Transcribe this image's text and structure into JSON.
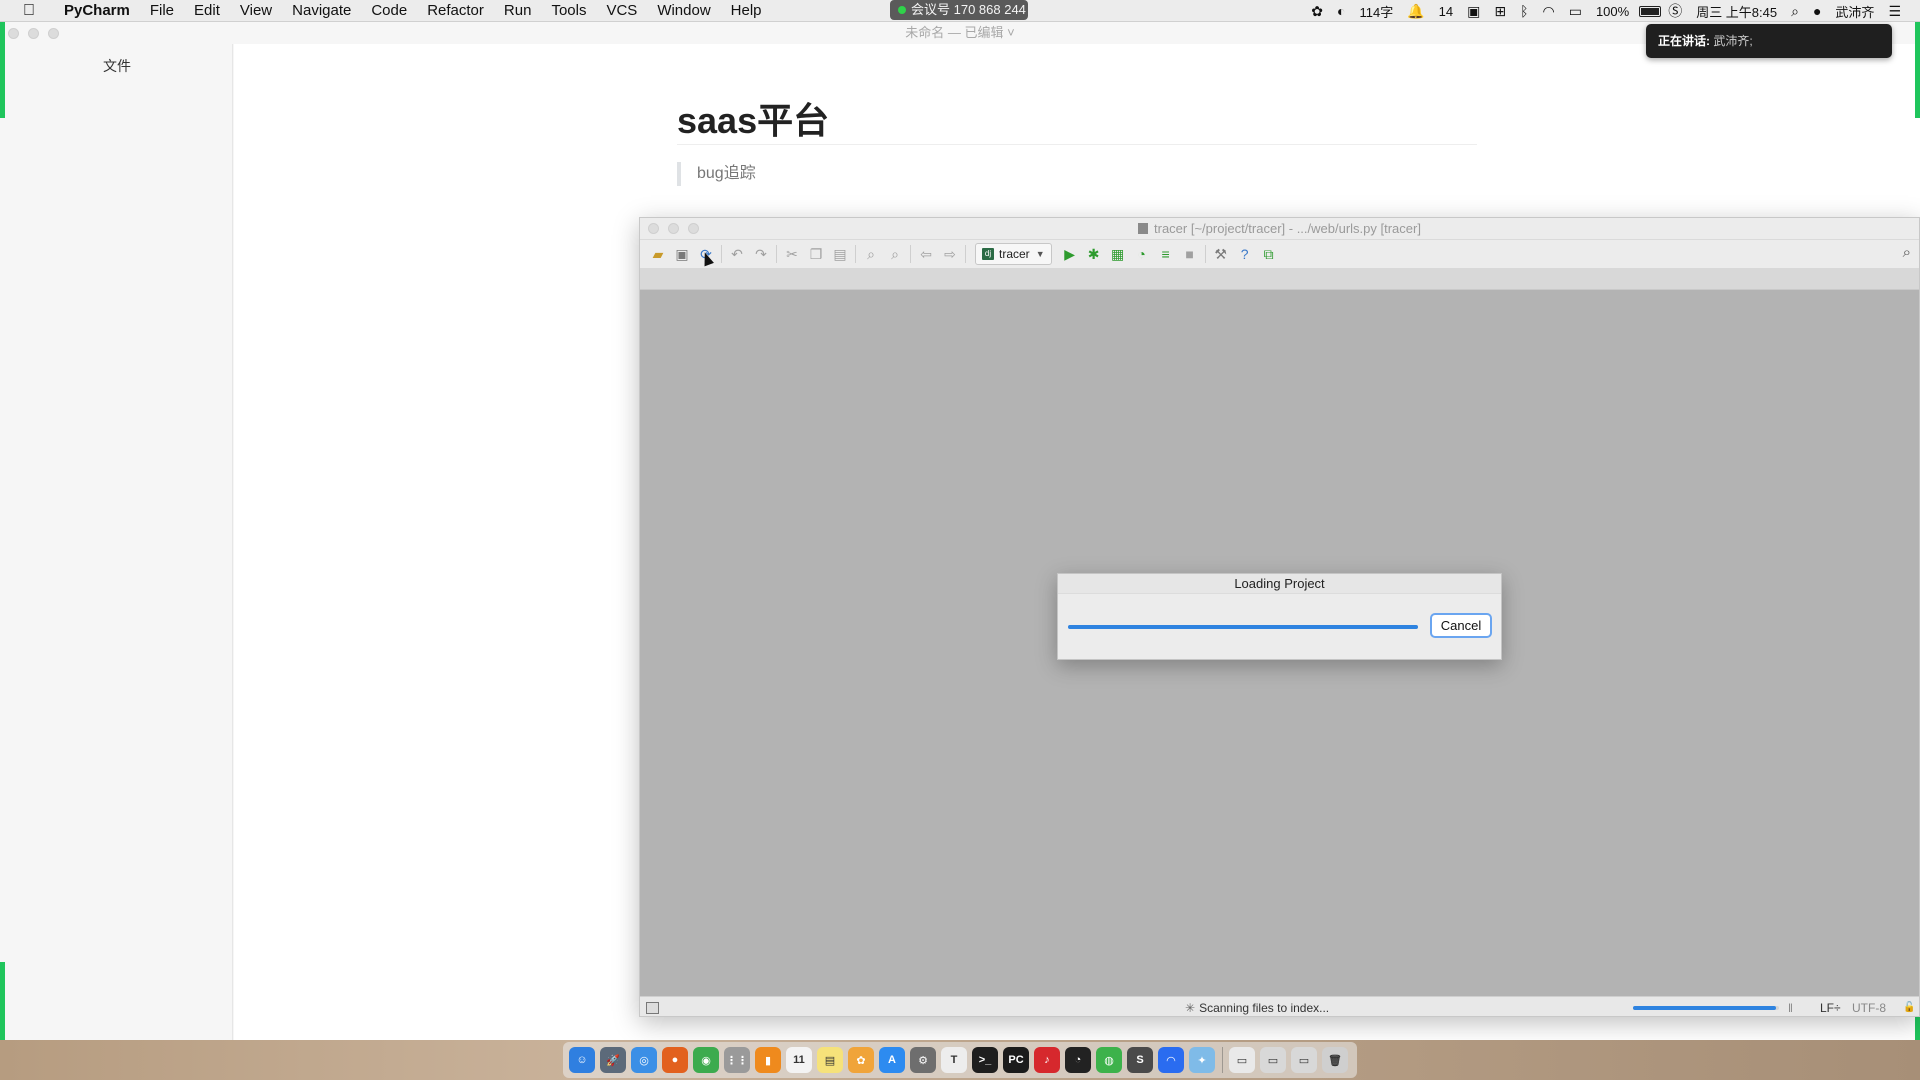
{
  "menubar": {
    "apple_icon": "apple-logo-icon",
    "app_name": "PyCharm",
    "menus": [
      "File",
      "Edit",
      "View",
      "Navigate",
      "Code",
      "Refactor",
      "Run",
      "Tools",
      "VCS",
      "Window",
      "Help"
    ],
    "meeting_label": "会议号 170 868 244",
    "status": {
      "word_count": "114字",
      "notification_count": "14",
      "battery": "100%",
      "datetime": "周三 上午8:45",
      "user": "武沛齐"
    }
  },
  "doc_window": {
    "title": "未命名 — 已编辑 ˅",
    "sidebar_label": "文件",
    "heading": "saas平台",
    "quote": "bug追踪"
  },
  "toast": {
    "label": "正在讲话:",
    "speaker": "武沛齐;"
  },
  "pycharm": {
    "title": "tracer [~/project/tracer] - .../web/urls.py [tracer]",
    "run_config": "tracer",
    "run_config_badge": "dj",
    "status": {
      "scanning": "Scanning files to index...",
      "line_separator": "LF÷",
      "encoding": "UTF-8",
      "index_progress": 0.98
    }
  },
  "dialog": {
    "title": "Loading Project",
    "cancel": "Cancel",
    "progress": 1.0
  },
  "colors": {
    "accent_green": "#1fc55c",
    "progress_blue": "#2e83e0",
    "cancel_focus": "#6aa5f0"
  },
  "dock": {
    "apps": [
      {
        "name": "finder",
        "color": "#2f7fe0",
        "glyph": "☺"
      },
      {
        "name": "launchpad",
        "color": "#5c6a7a",
        "glyph": "🚀"
      },
      {
        "name": "safari",
        "color": "#3b8fe6",
        "glyph": "◎"
      },
      {
        "name": "firefox",
        "color": "#e2611e",
        "glyph": "●"
      },
      {
        "name": "chrome",
        "color": "#3cab4e",
        "glyph": "◉"
      },
      {
        "name": "apps-grid",
        "color": "#9a9a9a",
        "glyph": "⋮⋮"
      },
      {
        "name": "books",
        "color": "#ef8a1d",
        "glyph": "▮"
      },
      {
        "name": "calendar",
        "color": "#f3f3f3",
        "glyph": "11"
      },
      {
        "name": "notes",
        "color": "#f6e27a",
        "glyph": "▤"
      },
      {
        "name": "photos",
        "color": "#f0a43a",
        "glyph": "✿"
      },
      {
        "name": "app-store",
        "color": "#2d8bf0",
        "glyph": "A"
      },
      {
        "name": "system-preferences",
        "color": "#6e6e6e",
        "glyph": "⚙"
      },
      {
        "name": "typora",
        "color": "#ededed",
        "glyph": "T"
      },
      {
        "name": "terminal",
        "color": "#1e1e1e",
        "glyph": ">_"
      },
      {
        "name": "pycharm",
        "color": "#1b1b1b",
        "glyph": "PC"
      },
      {
        "name": "netease-music",
        "color": "#d6282d",
        "glyph": "♪"
      },
      {
        "name": "qq",
        "color": "#222222",
        "glyph": "◔"
      },
      {
        "name": "wechat",
        "color": "#3db24b",
        "glyph": "◍"
      },
      {
        "name": "sublime",
        "color": "#4a4a4a",
        "glyph": "S"
      },
      {
        "name": "tencent-meeting",
        "color": "#2a6cf0",
        "glyph": "◠"
      },
      {
        "name": "misc-app",
        "color": "#7fbbe8",
        "glyph": "✦"
      }
    ],
    "extras": [
      {
        "name": "document-stack",
        "color": "#e9e9e9",
        "glyph": "▭"
      },
      {
        "name": "screenshot-folder",
        "color": "#d8d8d8",
        "glyph": "▭"
      },
      {
        "name": "downloads-folder",
        "color": "#d8d8d8",
        "glyph": "▭"
      },
      {
        "name": "trash",
        "color": "#cfcfcf",
        "glyph": "🗑"
      }
    ]
  }
}
